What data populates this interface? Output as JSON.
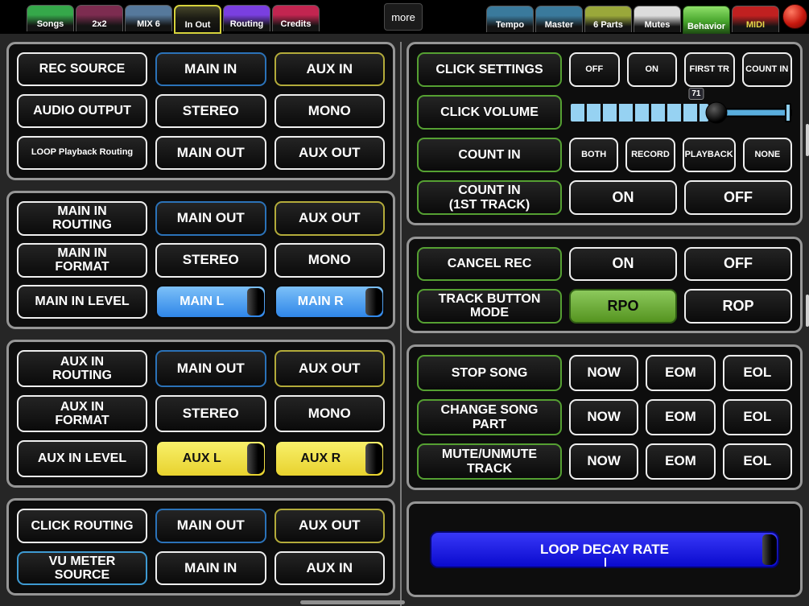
{
  "topbar": {
    "more": "more",
    "left_tabs": [
      {
        "label": "Songs",
        "color": "#35a84a"
      },
      {
        "label": "2x2",
        "color": "#7d2c50"
      },
      {
        "label": "MIX 6",
        "color": "#56799c"
      },
      {
        "label": "In Out",
        "color": "#c8c840"
      },
      {
        "label": "Routing",
        "color": "#7a3fe0"
      },
      {
        "label": "Credits",
        "color": "#c22550"
      }
    ],
    "right_tabs": [
      {
        "label": "Tempo",
        "color": "#3a7a9c"
      },
      {
        "label": "Master",
        "color": "#3a7a9c"
      },
      {
        "label": "6 Parts",
        "color": "#9aa83a"
      },
      {
        "label": "Mutes",
        "color": "#dcdcdc"
      },
      {
        "label": "Behavior",
        "color": "#55c840"
      },
      {
        "label": "MIDI",
        "color": "#c02020"
      }
    ]
  },
  "left": {
    "panel1": {
      "rows": [
        {
          "label": "REC SOURCE",
          "b1": "MAIN IN",
          "b2": "AUX IN"
        },
        {
          "label": "AUDIO OUTPUT",
          "b1": "STEREO",
          "b2": "MONO"
        },
        {
          "label": "LOOP Playback Routing",
          "b1": "MAIN OUT",
          "b2": "AUX OUT"
        }
      ]
    },
    "panel2": {
      "rows": [
        {
          "label": "MAIN IN\nROUTING",
          "b1": "MAIN OUT",
          "b2": "AUX OUT"
        },
        {
          "label": "MAIN IN\nFORMAT",
          "b1": "STEREO",
          "b2": "MONO"
        },
        {
          "label": "MAIN IN LEVEL",
          "s1": "MAIN L",
          "s2": "MAIN R"
        }
      ]
    },
    "panel3": {
      "rows": [
        {
          "label": "AUX IN\nROUTING",
          "b1": "MAIN OUT",
          "b2": "AUX OUT"
        },
        {
          "label": "AUX IN\nFORMAT",
          "b1": "STEREO",
          "b2": "MONO"
        },
        {
          "label": "AUX IN LEVEL",
          "s1": "AUX L",
          "s2": "AUX R"
        }
      ]
    },
    "panel4": {
      "rows": [
        {
          "label": "CLICK ROUTING",
          "b1": "MAIN OUT",
          "b2": "AUX OUT"
        },
        {
          "label": "VU METER\nSOURCE",
          "b1": "MAIN IN",
          "b2": "AUX IN"
        }
      ]
    }
  },
  "right": {
    "click_settings": {
      "label": "CLICK SETTINGS",
      "options": [
        "OFF",
        "ON",
        "FIRST TR",
        "COUNT IN"
      ]
    },
    "click_volume": {
      "label": "CLICK VOLUME",
      "value": "71"
    },
    "count_in": {
      "label": "COUNT IN",
      "options": [
        "BOTH",
        "RECORD",
        "PLAYBACK",
        "NONE"
      ]
    },
    "count_in_first": {
      "label": "COUNT IN\n(1ST TRACK)",
      "on": "ON",
      "off": "OFF"
    },
    "cancel_rec": {
      "label": "CANCEL REC",
      "on": "ON",
      "off": "OFF"
    },
    "track_button_mode": {
      "label": "TRACK BUTTON\nMODE",
      "rpo": "RPO",
      "rop": "ROP"
    },
    "stop_song": {
      "label": "STOP SONG",
      "options": [
        "NOW",
        "EOM",
        "EOL"
      ]
    },
    "change_song_part": {
      "label": "CHANGE SONG\nPART",
      "options": [
        "NOW",
        "EOM",
        "EOL"
      ]
    },
    "mute_unmute": {
      "label": "MUTE/UNMUTE\nTRACK",
      "options": [
        "NOW",
        "EOM",
        "EOL"
      ]
    },
    "loop_decay": {
      "label": "LOOP DECAY RATE"
    }
  }
}
